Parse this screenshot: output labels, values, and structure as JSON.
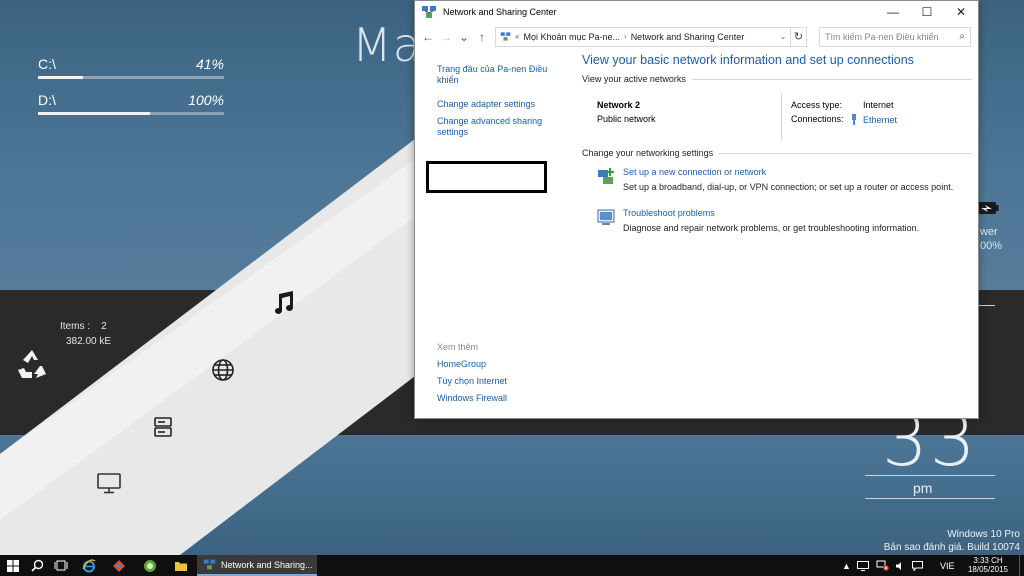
{
  "desktop": {
    "big_text": "Ma",
    "drives": [
      {
        "label": "C:\\",
        "percent": "41%",
        "fill": 0.41
      },
      {
        "label": "D:\\",
        "percent": "100%",
        "fill": 1.0
      }
    ],
    "recycle": {
      "items_label": "Items :",
      "items_count": "2",
      "size": "382.00 kE"
    },
    "right_labels": {
      "power": "wer",
      "power_pct": "00%"
    },
    "clock_digits": "33",
    "clock_ampm": "pm",
    "watermark": {
      "line1": "Windows 10 Pro",
      "line2": "Bản sao đánh giá. Build 10074"
    }
  },
  "window": {
    "title": "Network and Sharing Center",
    "controls": {
      "minimize": "—",
      "maximize": "☐",
      "close": "✕"
    },
    "nav": {
      "back": "←",
      "forward": "→",
      "recent": "⌄",
      "up": "↑"
    },
    "address": {
      "prefix": "«",
      "crumb1": "Mọi Khoản mục Pa-ne...",
      "sep": "›",
      "crumb2": "Network and Sharing Center",
      "dropdown": "⌄",
      "refresh": "↻"
    },
    "search": {
      "placeholder": "Tìm kiếm Pa-nen Điều khiển",
      "icon": "⌕"
    },
    "left": {
      "home_link": "Trang đầu của Pa-nen Điều khiển",
      "adapter_link": "Change adapter settings",
      "advanced_link": "Change advanced sharing settings",
      "see_also": "Xem thêm",
      "see_also_links": [
        "HomeGroup",
        "Tùy chọn Internet",
        "Windows Firewall"
      ]
    },
    "main": {
      "title": "View your basic network information and set up connections",
      "active_section": "View your active networks",
      "network_name": "Network  2",
      "network_type": "Public network",
      "access_label": "Access type:",
      "access_value": "Internet",
      "conn_label": "Connections:",
      "conn_value": "Ethernet",
      "settings_section": "Change your networking settings",
      "tasks": [
        {
          "link": "Set up a new connection or network",
          "desc": "Set up a broadband, dial-up, or VPN connection; or set up a router or access point."
        },
        {
          "link": "Troubleshoot problems",
          "desc": "Diagnose and repair network problems, or get troubleshooting information."
        }
      ]
    }
  },
  "taskbar": {
    "active_app": "Network and Sharing...",
    "tray": {
      "lang": "VIE"
    },
    "clock": {
      "time": "3:33 CH",
      "date": "18/05/2015"
    }
  },
  "colors": {
    "link": "#1a5ea8",
    "wallpaper": "#4a7193",
    "taskbar": "#0f0f0f"
  }
}
